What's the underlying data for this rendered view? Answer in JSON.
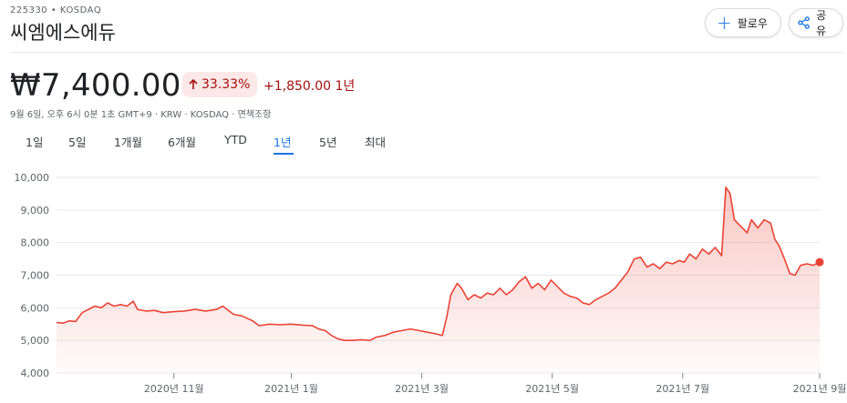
{
  "header": {
    "ticker": "225330 • KOSDAQ",
    "company": "씨엠에스에듀",
    "follow_label": "팔로우",
    "share_label": "공유"
  },
  "quote": {
    "price": "₩7,400.00",
    "pct_change": "33.33%",
    "abs_change": "+1,850.00 1년",
    "meta": "9월 6일, 오후 6시 0분 1초 GMT+9 · KRW · KOSDAQ · 면책조항"
  },
  "ranges": [
    "1일",
    "5일",
    "1개월",
    "6개월",
    "YTD",
    "1년",
    "5년",
    "최대"
  ],
  "active_range": "1년",
  "colors": {
    "line": "#ea4335",
    "accent": "#1a73e8",
    "negative_text": "#a50e0e",
    "badge_bg": "#fce8e6"
  },
  "chart_data": {
    "type": "area",
    "ylim": [
      4000,
      10000
    ],
    "yticks": [
      4000,
      5000,
      6000,
      7000,
      8000,
      9000,
      10000
    ],
    "ytick_labels": [
      "4,000",
      "5,000",
      "6,000",
      "7,000",
      "8,000",
      "9,000",
      "10,000"
    ],
    "xticks": [
      {
        "t": 9,
        "label": "2020년 11월"
      },
      {
        "t": 18,
        "label": "2021년 1월"
      },
      {
        "t": 28,
        "label": "2021년 3월"
      },
      {
        "t": 38,
        "label": "2021년 5월"
      },
      {
        "t": 48,
        "label": "2021년 7월"
      },
      {
        "t": 58.5,
        "label": "2021년 9월"
      }
    ],
    "t_range": [
      0,
      58.5
    ],
    "grid": true,
    "series": [
      {
        "points": [
          [
            0,
            5550
          ],
          [
            0.6,
            5530
          ],
          [
            1.2,
            5600
          ],
          [
            1.8,
            5580
          ],
          [
            2.4,
            5850
          ],
          [
            3.0,
            5950
          ],
          [
            3.6,
            6050
          ],
          [
            4.2,
            6000
          ],
          [
            4.8,
            6150
          ],
          [
            5.4,
            6050
          ],
          [
            6.0,
            6100
          ],
          [
            6.6,
            6050
          ],
          [
            7.2,
            6200
          ],
          [
            7.6,
            5950
          ],
          [
            8.4,
            5900
          ],
          [
            9.2,
            5920
          ],
          [
            10.0,
            5850
          ],
          [
            11.0,
            5880
          ],
          [
            12.0,
            5900
          ],
          [
            13.0,
            5950
          ],
          [
            14.0,
            5900
          ],
          [
            15.0,
            5950
          ],
          [
            15.6,
            6050
          ],
          [
            16.0,
            5950
          ],
          [
            16.6,
            5800
          ],
          [
            17.4,
            5750
          ],
          [
            18.4,
            5600
          ],
          [
            19.0,
            5450
          ],
          [
            20.0,
            5500
          ],
          [
            21.0,
            5480
          ],
          [
            22.0,
            5500
          ],
          [
            23.0,
            5470
          ],
          [
            24.0,
            5450
          ],
          [
            24.6,
            5350
          ],
          [
            25.2,
            5300
          ],
          [
            25.8,
            5150
          ],
          [
            26.4,
            5050
          ],
          [
            27.0,
            5000
          ],
          [
            27.8,
            5000
          ],
          [
            28.6,
            5020
          ],
          [
            29.4,
            5000
          ],
          [
            30.0,
            5100
          ],
          [
            30.8,
            5150
          ],
          [
            31.6,
            5250
          ],
          [
            32.4,
            5300
          ],
          [
            33.2,
            5350
          ],
          [
            34.0,
            5300
          ],
          [
            34.8,
            5250
          ],
          [
            35.6,
            5200
          ],
          [
            36.2,
            5150
          ],
          [
            36.6,
            5700
          ],
          [
            37.0,
            6400
          ],
          [
            37.6,
            6750
          ],
          [
            38.0,
            6600
          ],
          [
            38.6,
            6250
          ],
          [
            39.2,
            6400
          ],
          [
            39.8,
            6300
          ],
          [
            40.4,
            6450
          ],
          [
            41.0,
            6400
          ],
          [
            41.6,
            6600
          ],
          [
            42.2,
            6400
          ],
          [
            42.8,
            6550
          ],
          [
            43.4,
            6800
          ],
          [
            44.0,
            6950
          ],
          [
            44.6,
            6600
          ],
          [
            45.2,
            6750
          ],
          [
            45.8,
            6550
          ],
          [
            46.4,
            6850
          ],
          [
            47.0,
            6650
          ],
          [
            47.6,
            6450
          ],
          [
            48.2,
            6350
          ],
          [
            48.8,
            6300
          ],
          [
            49.4,
            6150
          ],
          [
            50.0,
            6100
          ],
          [
            50.6,
            6250
          ],
          [
            51.2,
            6350
          ],
          [
            51.8,
            6450
          ],
          [
            52.4,
            6600
          ],
          [
            53.0,
            6850
          ],
          [
            53.6,
            7100
          ],
          [
            54.2,
            7500
          ],
          [
            54.8,
            7550
          ],
          [
            55.4,
            7250
          ],
          [
            56.0,
            7350
          ],
          [
            56.6,
            7200
          ],
          [
            57.2,
            7400
          ],
          [
            57.8,
            7350
          ],
          [
            58.4,
            7450
          ],
          [
            58.9,
            7400
          ],
          [
            59.4,
            7650
          ],
          [
            60.0,
            7500
          ],
          [
            60.6,
            7800
          ],
          [
            61.2,
            7650
          ],
          [
            61.8,
            7850
          ],
          [
            62.4,
            7600
          ],
          [
            62.8,
            9700
          ],
          [
            63.2,
            9500
          ],
          [
            63.6,
            8700
          ],
          [
            64.2,
            8500
          ],
          [
            64.8,
            8300
          ],
          [
            65.2,
            8700
          ],
          [
            65.8,
            8450
          ],
          [
            66.4,
            8700
          ],
          [
            67.0,
            8600
          ],
          [
            67.4,
            8100
          ],
          [
            67.8,
            7900
          ],
          [
            68.3,
            7500
          ],
          [
            68.8,
            7050
          ],
          [
            69.3,
            7000
          ],
          [
            69.8,
            7300
          ],
          [
            70.4,
            7350
          ],
          [
            71.0,
            7300
          ],
          [
            71.6,
            7400
          ]
        ]
      }
    ],
    "last_value": 7400
  }
}
